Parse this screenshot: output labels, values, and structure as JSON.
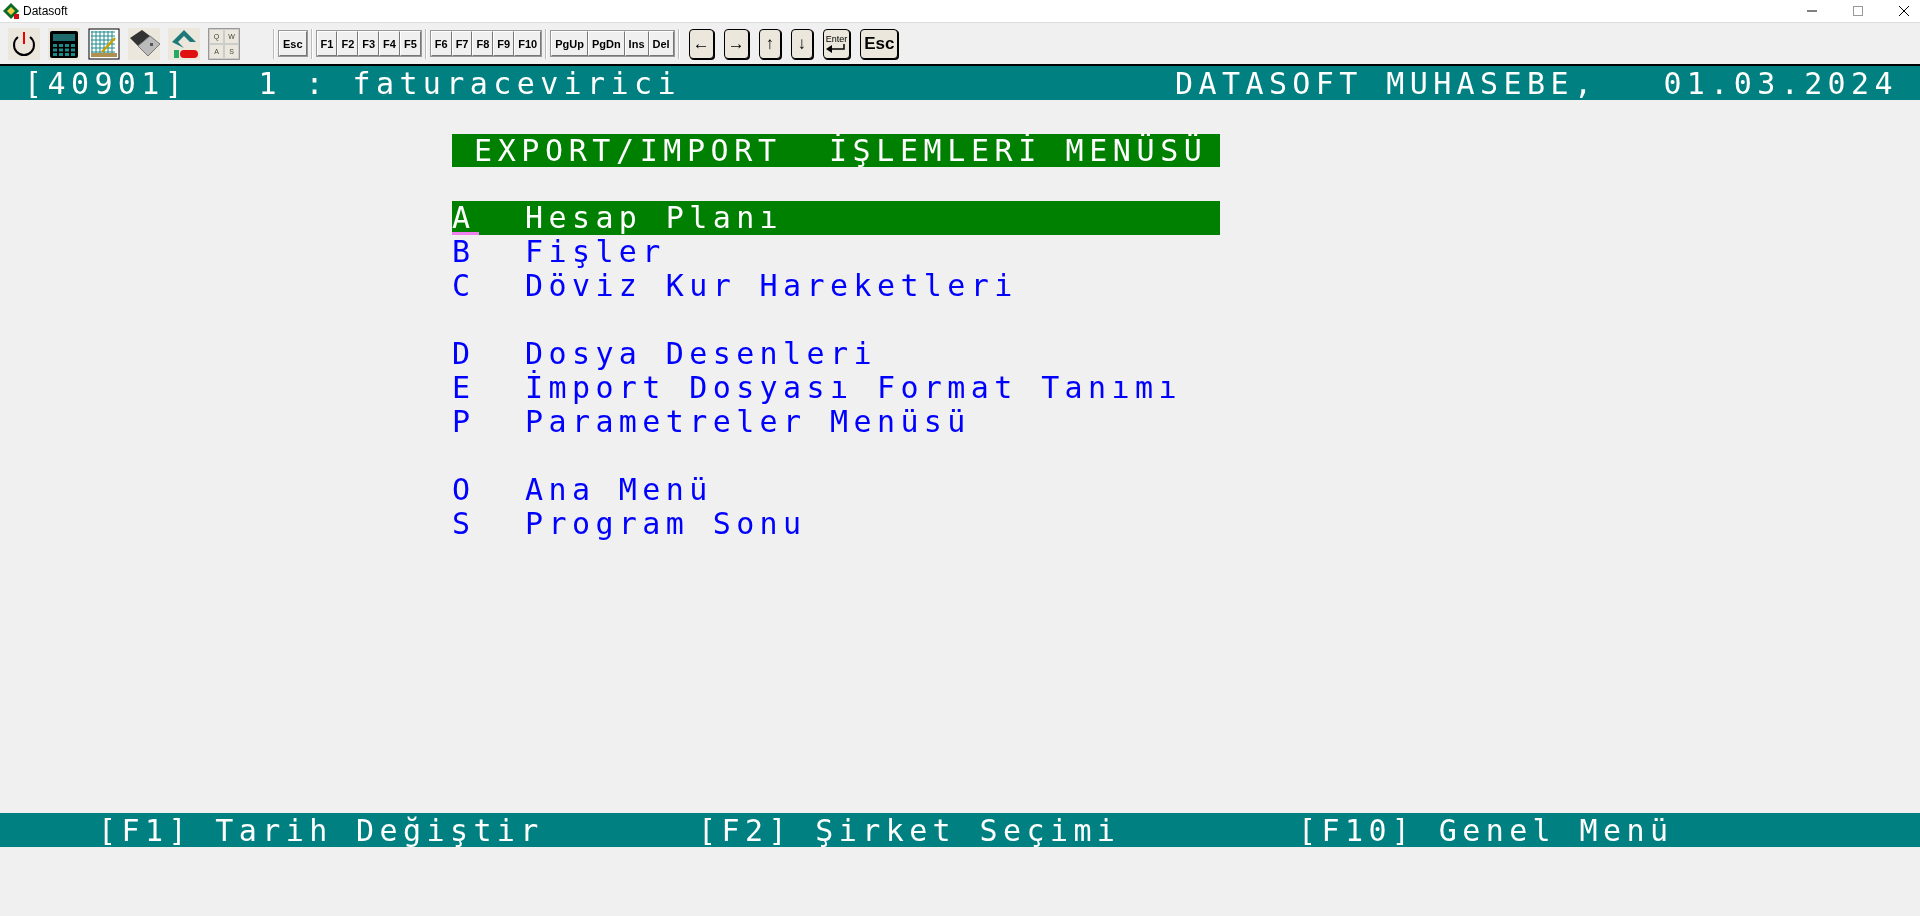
{
  "window": {
    "title": "Datasoft"
  },
  "toolbar": {
    "icons": [
      {
        "kind": "power"
      },
      {
        "kind": "calculator"
      },
      {
        "kind": "sheet"
      },
      {
        "kind": "usb"
      },
      {
        "kind": "hl"
      },
      {
        "kind": "keys",
        "keys": [
          "Q",
          "W",
          "A",
          "S"
        ]
      }
    ],
    "key_groups": [
      [
        "Esc"
      ],
      [
        "F1",
        "F2",
        "F3",
        "F4",
        "F5"
      ],
      [
        "F6",
        "F7",
        "F8",
        "F9",
        "F10"
      ],
      [
        "PgUp",
        "PgDn",
        "Ins",
        "Del"
      ]
    ],
    "nav_keys": [
      {
        "kind": "char",
        "label": "←"
      },
      {
        "kind": "char",
        "label": "→"
      },
      {
        "kind": "char",
        "label": "↑"
      },
      {
        "kind": "char",
        "label": "↓"
      },
      {
        "kind": "enter",
        "label": "Enter"
      },
      {
        "kind": "char",
        "label": "Esc"
      }
    ]
  },
  "header": {
    "left": "[40901]   1 : faturacevirici",
    "company": "DATASOFT MUHASEBE,",
    "date": "01.03.2024"
  },
  "menu": {
    "title": "EXPORT/IMPORT  İŞLEMLERİ MENÜSÜ",
    "groups": [
      [
        {
          "key": "A",
          "label": "Hesap Planı",
          "selected": true
        },
        {
          "key": "B",
          "label": "Fişler",
          "selected": false
        },
        {
          "key": "C",
          "label": "Döviz Kur Hareketleri",
          "selected": false
        }
      ],
      [
        {
          "key": "D",
          "label": "Dosya Desenleri",
          "selected": false
        },
        {
          "key": "E",
          "label": "İmport Dosyası Format Tanımı",
          "selected": false
        },
        {
          "key": "P",
          "label": "Parametreler Menüsü",
          "selected": false
        }
      ],
      [
        {
          "key": "O",
          "label": "Ana Menü",
          "selected": false
        },
        {
          "key": "S",
          "label": "Program Sonu",
          "selected": false
        }
      ]
    ]
  },
  "footer": [
    "[F1] Tarih Değiştir",
    "[F2] Şirket Seçimi",
    "[F10] Genel Menü"
  ]
}
